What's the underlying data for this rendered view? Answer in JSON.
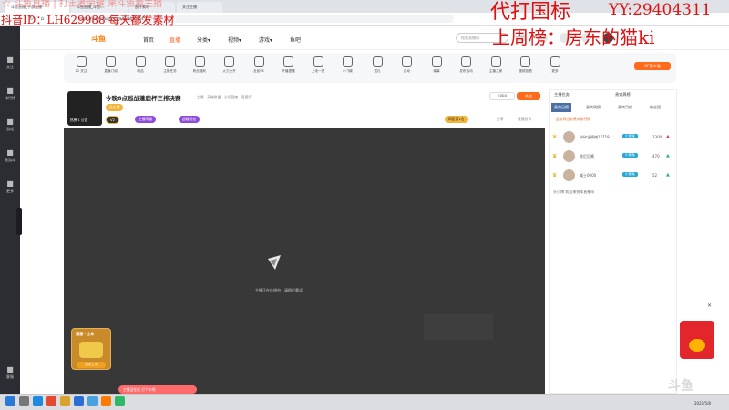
{
  "browser": {
    "tabs": [
      "斗鱼直播_手游直播",
      "斗鱼直播_斗鱼...",
      "图片素材",
      "关注主播"
    ],
    "address": "https://www.douyu.com/622450454",
    "nav_icons": [
      "back-icon",
      "forward-icon",
      "refresh-icon",
      "home-icon"
    ]
  },
  "overlay": {
    "line_top": "☆ 斗鱼直播 | 打王者荣耀 来斗鱼看主播",
    "line_mid": "抖音ID：LH629988 每天都发素材",
    "big_right1": "代打国标",
    "big_right2": "YY:29404311",
    "big_right3": "上周榜：房东的猫ki"
  },
  "sidebar": [
    {
      "icon": "heart-icon",
      "label": "关注"
    },
    {
      "icon": "list-icon",
      "label": "排行榜"
    },
    {
      "icon": "game-icon",
      "label": "游戏"
    },
    {
      "icon": "star-icon",
      "label": "云游戏"
    },
    {
      "icon": "grid-icon",
      "label": "更多"
    },
    {
      "icon": "headset-icon",
      "label": "客服"
    }
  ],
  "header": {
    "logo": "斗鱼",
    "nav": [
      "首页",
      "直播",
      "分类▾",
      "视频▾",
      "游戏▾",
      "鱼吧"
    ],
    "search_placeholder": "搜索直播间",
    "icons": [
      "history-icon",
      "star-icon",
      "download-icon",
      "message-icon",
      "user-icon"
    ]
  },
  "categories": [
    "12 关注",
    "直播订阅",
    "精品",
    "主播任务",
    "粉丝福利",
    "火力全开",
    "全民PK",
    "开播提醒",
    "上电一把",
    "小飞碟",
    "送礼",
    "自动",
    "弹幕",
    "发布活动",
    "主播之家",
    "视频投稿",
    "更多"
  ],
  "pc_button": "PC客户端",
  "streamer": {
    "title": "今晚6点巡战蓬鹿杯三排决赛",
    "category": "主播 · 英雄联盟 · 永恒国度 · 蓬鹿杯",
    "badges": [
      "头小博",
      "V2",
      "主播等级",
      "超级粉丝"
    ],
    "rank_label": "四区第1名",
    "follow_label": "关注",
    "follow_count": "1888",
    "extra": [
      "分享",
      "直播投诉"
    ],
    "avatar_text": "热榜 1 公告"
  },
  "video": {
    "message": "主播正在连线中，请稍后重试",
    "promo_bottom": "主播没在线 打个卡吧",
    "car_promo": [
      "漂漂 · 上车",
      "立即上车"
    ]
  },
  "right_panel": {
    "tabs": [
      "主播任务",
      "贵宾周榜"
    ],
    "subtabs": [
      "贵宾日榜",
      "贵宾周榜",
      "贵宾月榜",
      "粉丝团"
    ],
    "notice": "此房间当前贵宾排行榜",
    "ranks": [
      {
        "name": "碎碎念情绪17718",
        "level": "小兔兔",
        "score": "2300",
        "arrow": "▲",
        "arrow_color": "#e23d3d"
      },
      {
        "name": "欧尼尼酱",
        "level": "小兔兔",
        "score": "470",
        "arrow": "▲",
        "arrow_color": "#2fb86a"
      },
      {
        "name": "威士0000",
        "level": "小兔兔",
        "score": "52",
        "arrow": "▲",
        "arrow_color": "#2fb86a"
      }
    ],
    "chat": "头小博 欢迎来到本直播间"
  },
  "taskbar": {
    "clock": "2021/5/8",
    "icons": [
      "windows-icon",
      "search-icon",
      "edge-icon",
      "chrome-icon",
      "file-icon",
      "mail-icon",
      "photo-icon",
      "douyu-icon",
      "wechat-icon"
    ]
  }
}
